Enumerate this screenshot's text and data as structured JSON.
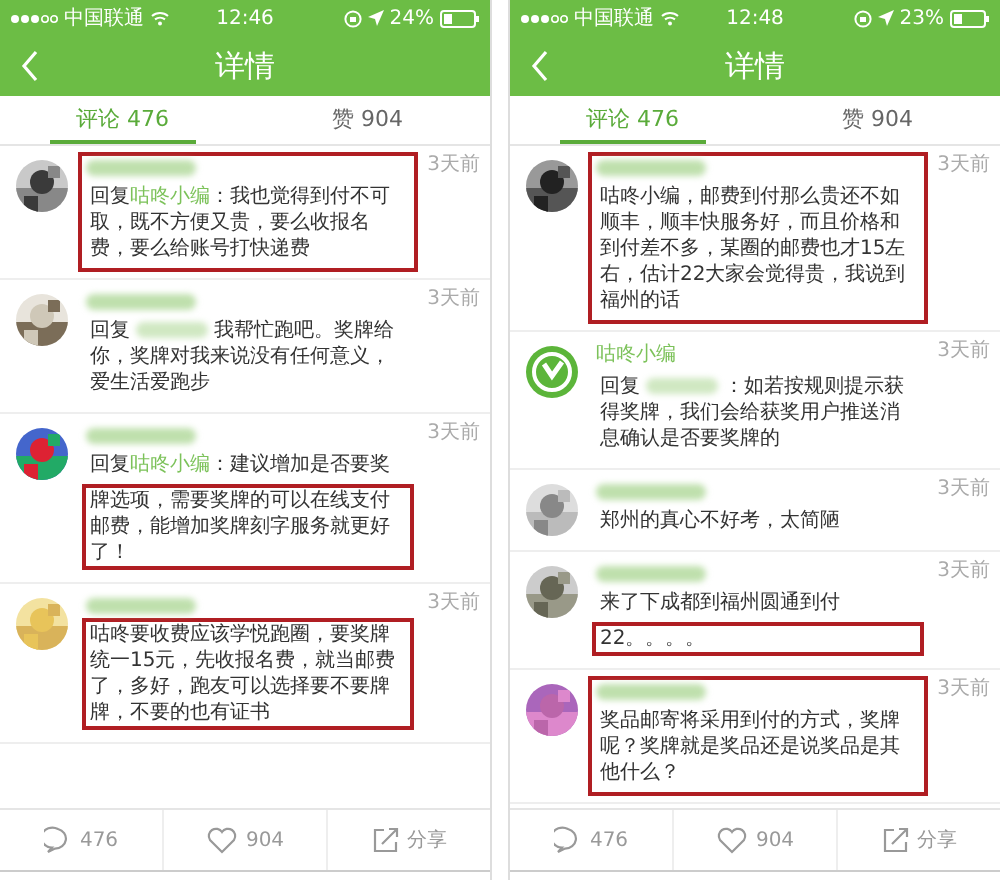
{
  "phones": [
    {
      "status_bar": {
        "carrier": "中国联通",
        "time": "12:46",
        "battery": "24%"
      },
      "title": "详情",
      "tabs": [
        {
          "label": "评论 476",
          "selected": true
        },
        {
          "label": "赞 904",
          "selected": false
        }
      ],
      "comments": [
        {
          "avatar": {
            "kind": "picture"
          },
          "name_blurred": true,
          "time": "3天前",
          "highlighted": true,
          "reply": {
            "prefix": "回复",
            "to": "咕咚小编"
          },
          "parts": [
            {
              "text": "：我也觉得到付不可取，既不方便又贵，要么收报名费，要么给账号打快递费",
              "highlighted": false
            }
          ]
        },
        {
          "avatar": {
            "kind": "picture"
          },
          "name_blurred": true,
          "time": "3天前",
          "highlighted": false,
          "reply": {
            "prefix": "回复",
            "to_blurred": true
          },
          "parts": [
            {
              "text": "我帮忙跑吧。奖牌给你，奖牌对我来说没有任何意义，爱生活爱跑步",
              "highlighted": false
            }
          ]
        },
        {
          "avatar": {
            "kind": "picture"
          },
          "name_blurred": true,
          "time": "3天前",
          "highlighted": false,
          "reply": {
            "prefix": "回复",
            "to": "咕咚小编"
          },
          "parts": [
            {
              "text": "：建议增加是否要奖",
              "highlighted": false
            },
            {
              "text": "牌选项，需要奖牌的可以在线支付邮费，能增加奖牌刻字服务就更好了！",
              "highlighted": true
            }
          ]
        },
        {
          "avatar": {
            "kind": "picture"
          },
          "name_blurred": true,
          "time": "3天前",
          "highlighted": false,
          "parts": [
            {
              "text": "咕咚要收费应该学悦跑圈，要奖牌统一15元，先收报名费，就当邮费了，多好，跑友可以选择要不要牌牌，不要的也有证书",
              "highlighted": true
            }
          ]
        }
      ],
      "actions": [
        {
          "kind": "comment",
          "label": "476"
        },
        {
          "kind": "like",
          "label": "904"
        },
        {
          "kind": "share",
          "label": "分享"
        }
      ]
    },
    {
      "status_bar": {
        "carrier": "中国联通",
        "time": "12:48",
        "battery": "23%"
      },
      "title": "详情",
      "tabs": [
        {
          "label": "评论 476",
          "selected": true
        },
        {
          "label": "赞 904",
          "selected": false
        }
      ],
      "comments": [
        {
          "avatar": {
            "kind": "picture"
          },
          "name_blurred": true,
          "time": "3天前",
          "highlighted": true,
          "parts": [
            {
              "text": "咕咚小编，邮费到付那么贵还不如顺丰，顺丰快服务好，而且价格和到付差不多，某圈的邮费也才15左右，估计22大家会觉得贵，我说到福州的话",
              "highlighted": false
            }
          ]
        },
        {
          "avatar": {
            "kind": "logo"
          },
          "name": "咕咚小编",
          "time": "3天前",
          "highlighted": false,
          "reply": {
            "prefix": "回复",
            "to_blurred": true
          },
          "parts": [
            {
              "text": "：如若按规则提示获得奖牌，我们会给获奖用户推送消息确认是否要奖牌的",
              "highlighted": false
            }
          ]
        },
        {
          "avatar": {
            "kind": "picture"
          },
          "name_blurred": true,
          "time": "3天前",
          "highlighted": false,
          "parts": [
            {
              "text": "郑州的真心不好考，太简陋",
              "highlighted": false
            }
          ]
        },
        {
          "avatar": {
            "kind": "picture"
          },
          "name_blurred": true,
          "time": "3天前",
          "highlighted": false,
          "parts": [
            {
              "text": "来了下成都到福州圆通到付",
              "highlighted": false
            },
            {
              "text": "22。。。。",
              "highlighted": true
            }
          ]
        },
        {
          "avatar": {
            "kind": "picture"
          },
          "name_blurred": true,
          "time": "3天前",
          "highlighted": true,
          "parts": [
            {
              "text": "奖品邮寄将采用到付的方式，奖牌呢？奖牌就是奖品还是说奖品是其他什么？",
              "highlighted": false
            }
          ]
        }
      ],
      "actions": [
        {
          "kind": "comment",
          "label": "476"
        },
        {
          "kind": "like",
          "label": "904"
        },
        {
          "kind": "share",
          "label": "分享"
        }
      ]
    }
  ]
}
